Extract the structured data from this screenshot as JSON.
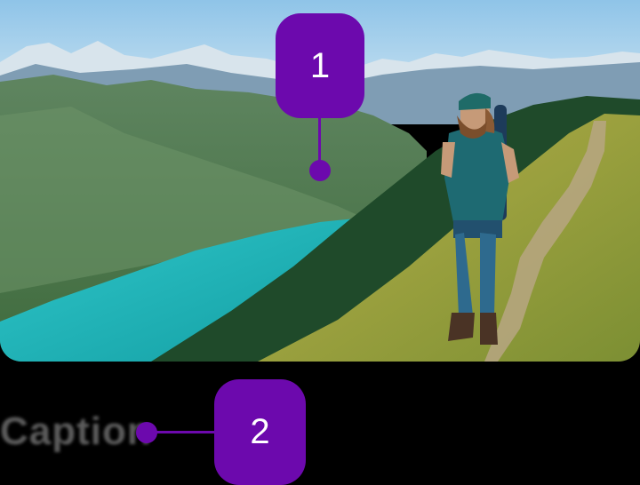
{
  "image": {
    "subject": "hiker-on-mountain-ridge-above-lake",
    "alt": ""
  },
  "caption": {
    "text": "Caption"
  },
  "annotations": [
    {
      "number": "1"
    },
    {
      "number": "2"
    }
  ],
  "colors": {
    "accent": "#6c09ad",
    "background": "#000000",
    "caption_text": "#5b5b5b"
  },
  "icons": [
    "hiker-photo",
    "callout-dot"
  ]
}
